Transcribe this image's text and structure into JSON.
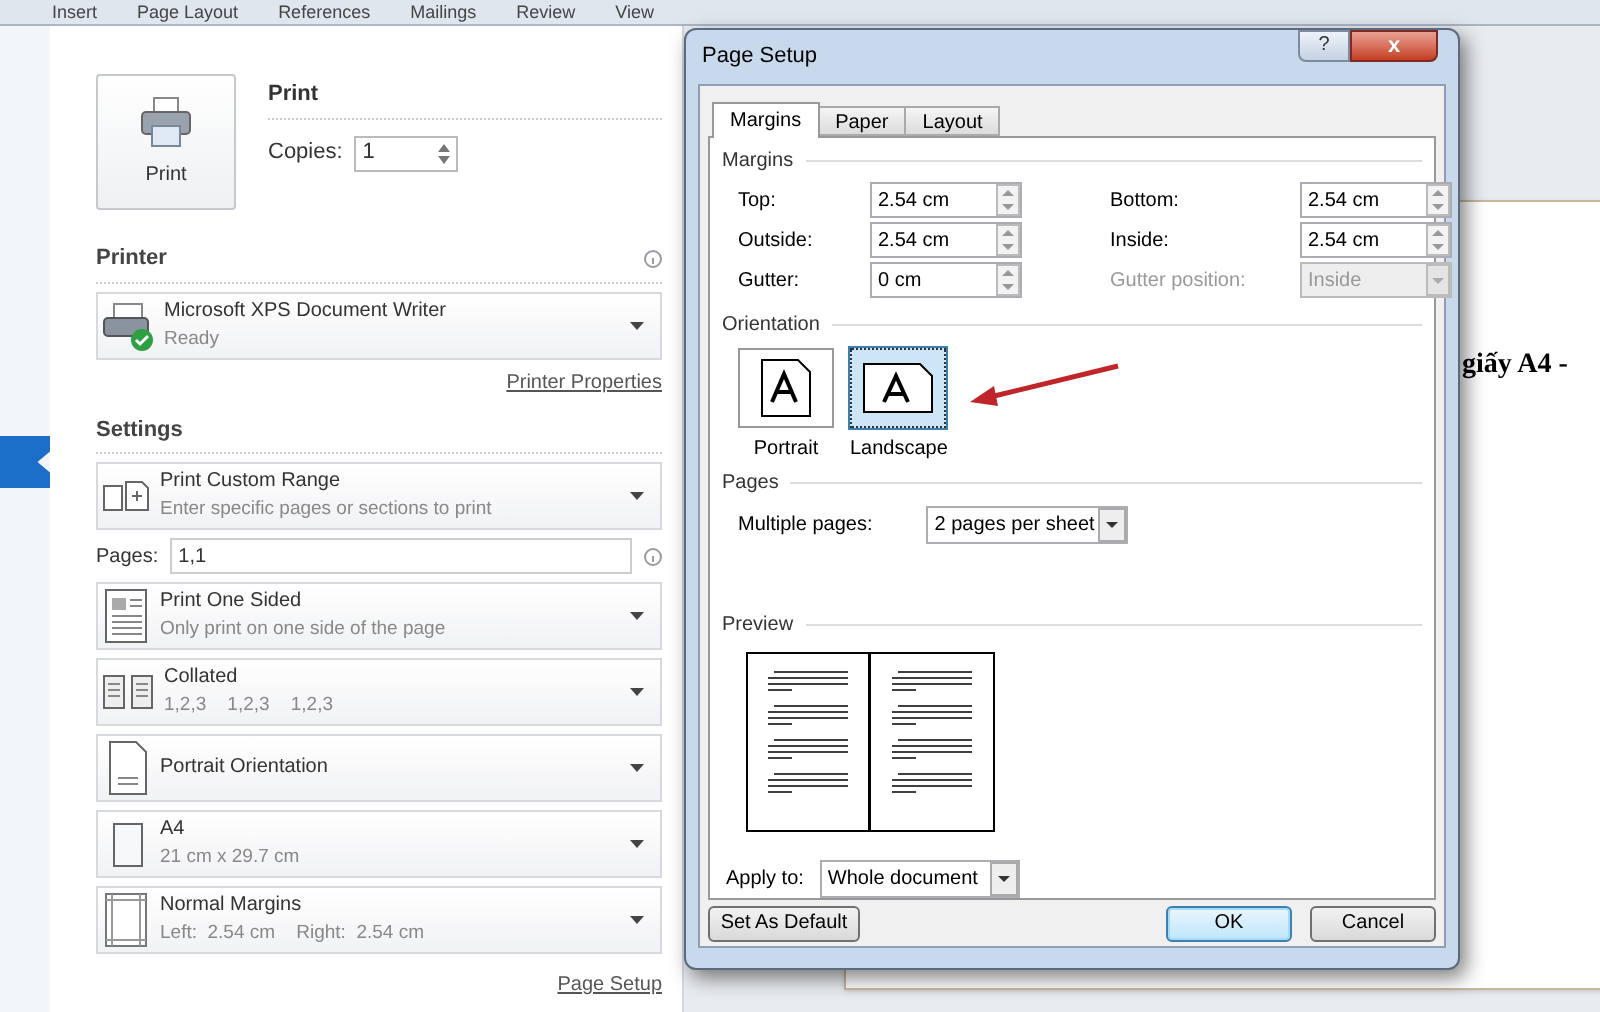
{
  "ribbon_tabs": [
    "Insert",
    "Page Layout",
    "References",
    "Mailings",
    "Review",
    "View"
  ],
  "print": {
    "button_label": "Print",
    "heading": "Print",
    "copies_label": "Copies:",
    "copies_value": "1"
  },
  "printer": {
    "heading": "Printer",
    "name": "Microsoft XPS Document Writer",
    "status": "Ready",
    "properties_link": "Printer Properties"
  },
  "settings": {
    "heading": "Settings",
    "range": {
      "title": "Print Custom Range",
      "subtitle": "Enter specific pages or sections to print"
    },
    "pages": {
      "label": "Pages:",
      "value": "1,1"
    },
    "options": [
      {
        "title": "Print One Sided",
        "subtitle": "Only print on one side of the page"
      },
      {
        "title": "Collated",
        "subtitle": "1,2,3    1,2,3    1,2,3"
      },
      {
        "title": "Portrait Orientation"
      },
      {
        "title": "A4",
        "subtitle": "21 cm x 29.7 cm"
      },
      {
        "title": "Normal Margins",
        "subtitle": "Left:  2.54 cm    Right:  2.54 cm"
      }
    ],
    "page_setup_link": "Page Setup"
  },
  "document": {
    "text": "giấy A4 -"
  },
  "dialog": {
    "title": "Page Setup",
    "help_button": "?",
    "close_button": "x",
    "tabs": [
      {
        "label": "Margins",
        "selected": true
      },
      {
        "label": "Paper",
        "selected": false
      },
      {
        "label": "Layout",
        "selected": false
      }
    ],
    "margins": {
      "heading": "Margins",
      "fields": [
        {
          "label": "Top:",
          "value": "2.54 cm",
          "disabled": false,
          "kind": "spin"
        },
        {
          "label": "Bottom:",
          "value": "2.54 cm",
          "disabled": false,
          "kind": "spin"
        },
        {
          "label": "Outside:",
          "value": "2.54 cm",
          "disabled": false,
          "kind": "spin"
        },
        {
          "label": "Inside:",
          "value": "2.54 cm",
          "disabled": false,
          "kind": "spin"
        },
        {
          "label": "Gutter:",
          "value": "0 cm",
          "disabled": false,
          "kind": "spin"
        },
        {
          "label": "Gutter position:",
          "value": "Inside",
          "disabled": true,
          "kind": "select"
        }
      ]
    },
    "orientation": {
      "heading": "Orientation",
      "options": [
        {
          "label": "Portrait",
          "selected": false
        },
        {
          "label": "Landscape",
          "selected": true
        }
      ]
    },
    "pages": {
      "heading": "Pages",
      "label": "Multiple pages:",
      "value": "2 pages per sheet"
    },
    "preview": {
      "heading": "Preview"
    },
    "apply_to": {
      "label": "Apply to:",
      "value": "Whole document"
    },
    "buttons": [
      {
        "label": "Set As Default",
        "default": false
      },
      {
        "label": "OK",
        "default": true
      },
      {
        "label": "Cancel",
        "default": false
      }
    ]
  }
}
